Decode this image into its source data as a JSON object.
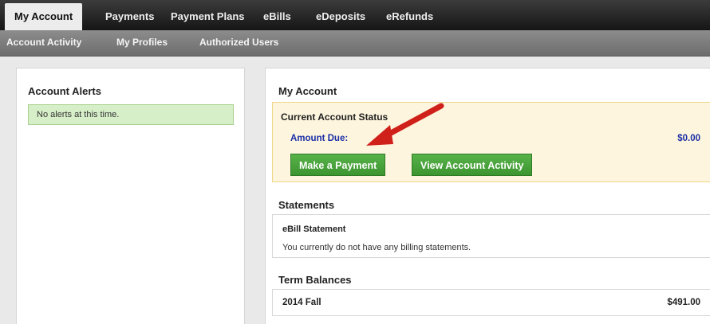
{
  "nav": {
    "tabs": [
      "My Account",
      "Payments",
      "Payment Plans",
      "eBills",
      "eDeposits",
      "eRefunds"
    ],
    "active_tab": "My Account",
    "subtabs": [
      "Account Activity",
      "My Profiles",
      "Authorized Users"
    ]
  },
  "alerts": {
    "title": "Account Alerts",
    "message": "No alerts at this time."
  },
  "account": {
    "title": "My Account",
    "status_title": "Current Account Status",
    "amount_due_label": "Amount Due:",
    "amount_due_value": "$0.00",
    "make_payment_label": "Make a Payment",
    "view_activity_label": "View Account Activity"
  },
  "statements": {
    "title": "Statements",
    "item_name": "eBill Statement",
    "message": "You currently do not have any billing statements."
  },
  "term_balances": {
    "title": "Term Balances",
    "term": "2014 Fall",
    "amount": "$491.00"
  },
  "colors": {
    "button_green": "#3c9530",
    "amount_blue": "#1c2fa8",
    "alert_green": "#d6efc8",
    "status_yellow": "#fdf5dd",
    "arrow_red": "#d0201a"
  }
}
